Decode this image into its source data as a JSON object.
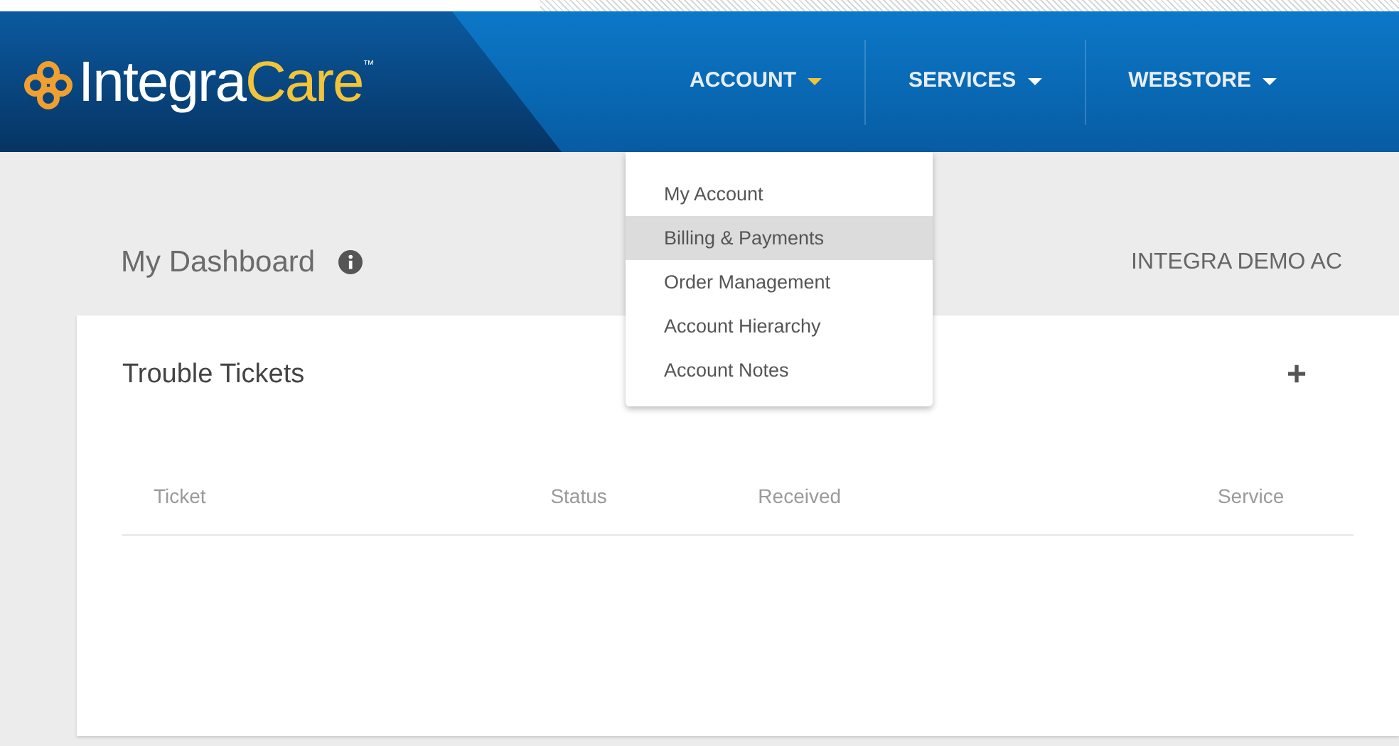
{
  "logo": {
    "brand": "Integra",
    "accent": "Care",
    "mark": "™"
  },
  "nav": [
    {
      "label": "ACCOUNT",
      "selected": true
    },
    {
      "label": "SERVICES",
      "selected": false
    },
    {
      "label": "WEBSTORE",
      "selected": false
    }
  ],
  "dropdown": [
    {
      "label": "My Account",
      "selected": false
    },
    {
      "label": "Billing & Payments",
      "selected": true
    },
    {
      "label": "Order Management",
      "selected": false
    },
    {
      "label": "Account Hierarchy",
      "selected": false
    },
    {
      "label": "Account Notes",
      "selected": false
    }
  ],
  "page": {
    "title": "My Dashboard",
    "account": "INTEGRA DEMO AC"
  },
  "card": {
    "title": "Trouble Tickets",
    "add": "+",
    "columns": [
      "Ticket",
      "Status",
      "Received",
      "Service"
    ]
  }
}
